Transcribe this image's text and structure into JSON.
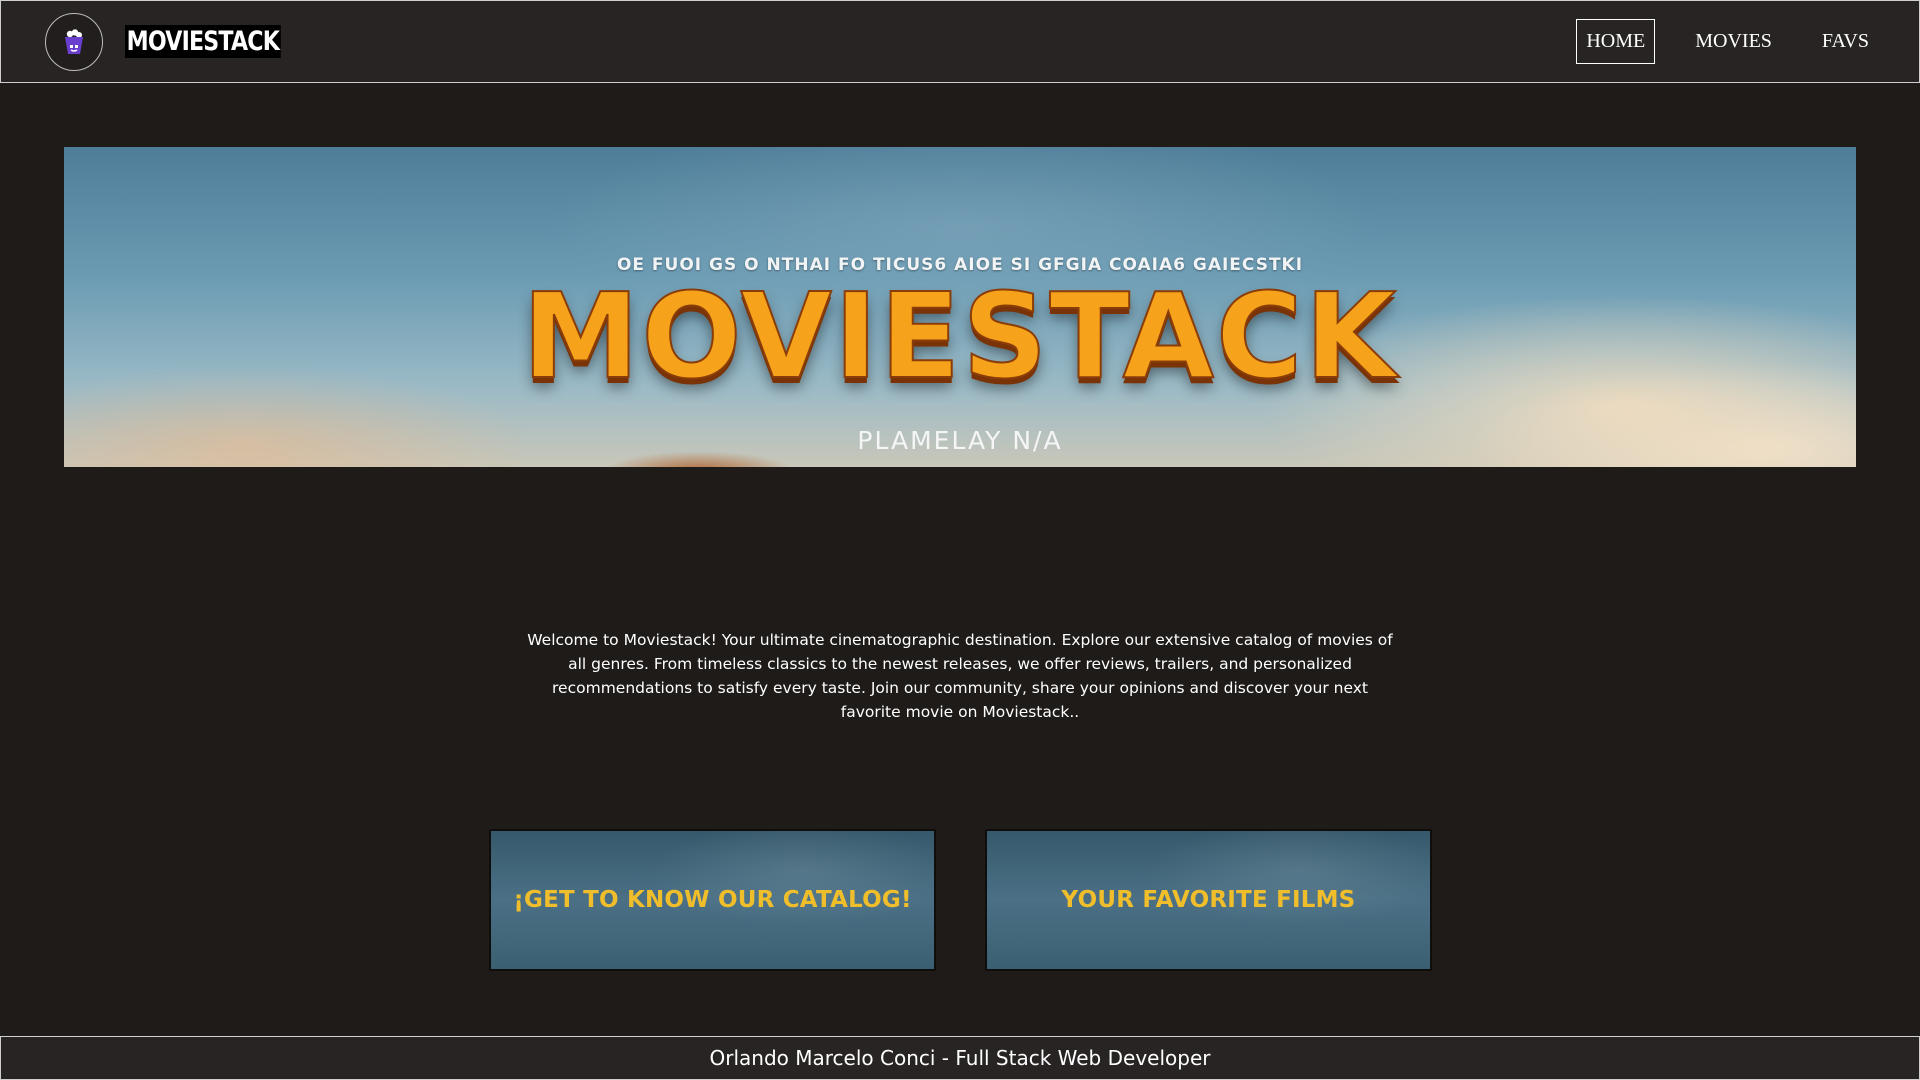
{
  "header": {
    "logo_icon": "popcorn-box-icon",
    "brand": "MOVIESTACK",
    "nav": [
      {
        "label": "HOME",
        "active": true
      },
      {
        "label": "MOVIES",
        "active": false
      },
      {
        "label": "FAVS",
        "active": false
      }
    ]
  },
  "hero": {
    "tagline": "OE FUOI GS O NTHAI FO TICUS6 AIOE SI GFGIA COAIA6 GAIECSTKI",
    "title": "MOVIESTACK",
    "subtitle": "PLAMELAY  N/A"
  },
  "intro": {
    "text": "Welcome to Moviestack! Your ultimate cinematographic destination. Explore our extensive catalog of movies of all genres. From timeless classics to the newest releases, we offer reviews, trailers, and personalized recommendations to satisfy every taste. Join our community, share your opinions and discover your next favorite movie on Moviestack.."
  },
  "buttons": {
    "catalog": "¡GET TO KNOW OUR CATALOG!",
    "favorites": "YOUR FAVORITE FILMS"
  },
  "footer": {
    "text": "Orlando Marcelo Conci - Full Stack Web Developer"
  },
  "colors": {
    "background": "#1e1b19",
    "header_bg": "#282423",
    "cta_text": "#f1be2b",
    "hero_title": "#f7a21b"
  }
}
